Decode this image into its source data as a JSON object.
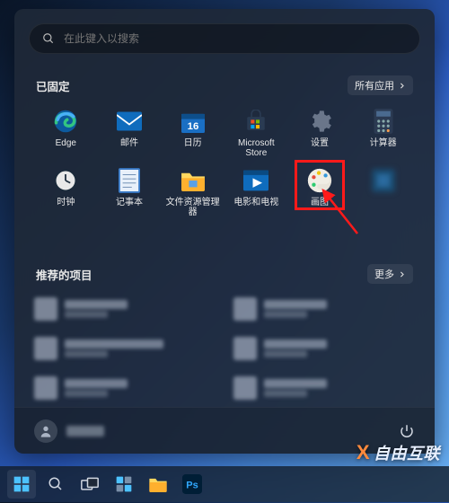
{
  "search": {
    "placeholder": "在此键入以搜索"
  },
  "pinned": {
    "title": "已固定",
    "all_apps": "所有应用",
    "apps": [
      {
        "id": "edge",
        "label": "Edge"
      },
      {
        "id": "mail",
        "label": "邮件"
      },
      {
        "id": "calendar",
        "label": "日历"
      },
      {
        "id": "store",
        "label": "Microsoft Store"
      },
      {
        "id": "settings",
        "label": "设置"
      },
      {
        "id": "calculator",
        "label": "计算器"
      },
      {
        "id": "clock",
        "label": "时钟"
      },
      {
        "id": "notepad",
        "label": "记事本"
      },
      {
        "id": "explorer",
        "label": "文件资源管理器"
      },
      {
        "id": "movies",
        "label": "电影和电视"
      },
      {
        "id": "paint",
        "label": "画图",
        "highlighted": true
      },
      {
        "id": "blurred",
        "label": "",
        "blurred": true
      }
    ]
  },
  "recommended": {
    "title": "推荐的项目",
    "more": "更多",
    "items": [
      {},
      {},
      {},
      {},
      {},
      {}
    ]
  },
  "footer": {
    "power_tooltip": "电源"
  },
  "watermark": {
    "text": "自由互联"
  },
  "colors": {
    "highlight": "#ff1a1a",
    "accent_blue": "#0078d4"
  }
}
